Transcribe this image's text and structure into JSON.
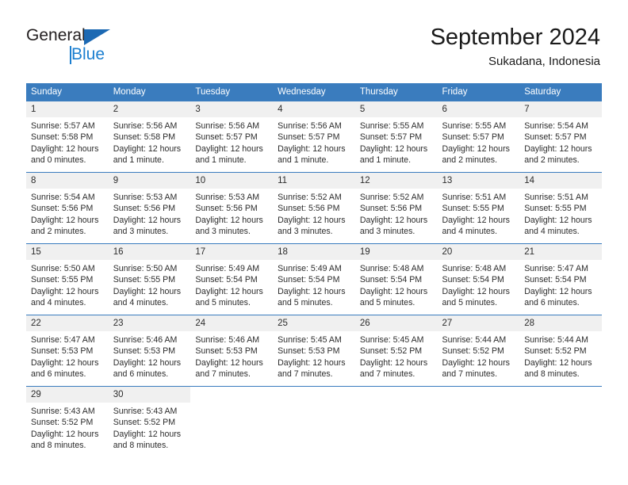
{
  "brand": {
    "name_top": "General",
    "name_bottom": "Blue",
    "accent_color": "#1c7fd0",
    "triangle_color": "#1c69b3"
  },
  "header": {
    "title": "September 2024",
    "subtitle": "Sukadana, Indonesia"
  },
  "calendar": {
    "header_bg": "#3a7cbe",
    "daynum_bg": "#f0f0f0",
    "weekdays": [
      "Sunday",
      "Monday",
      "Tuesday",
      "Wednesday",
      "Thursday",
      "Friday",
      "Saturday"
    ],
    "weeks": [
      [
        {
          "day": "1",
          "sunrise": "Sunrise: 5:57 AM",
          "sunset": "Sunset: 5:58 PM",
          "daylight1": "Daylight: 12 hours",
          "daylight2": "and 0 minutes."
        },
        {
          "day": "2",
          "sunrise": "Sunrise: 5:56 AM",
          "sunset": "Sunset: 5:58 PM",
          "daylight1": "Daylight: 12 hours",
          "daylight2": "and 1 minute."
        },
        {
          "day": "3",
          "sunrise": "Sunrise: 5:56 AM",
          "sunset": "Sunset: 5:57 PM",
          "daylight1": "Daylight: 12 hours",
          "daylight2": "and 1 minute."
        },
        {
          "day": "4",
          "sunrise": "Sunrise: 5:56 AM",
          "sunset": "Sunset: 5:57 PM",
          "daylight1": "Daylight: 12 hours",
          "daylight2": "and 1 minute."
        },
        {
          "day": "5",
          "sunrise": "Sunrise: 5:55 AM",
          "sunset": "Sunset: 5:57 PM",
          "daylight1": "Daylight: 12 hours",
          "daylight2": "and 1 minute."
        },
        {
          "day": "6",
          "sunrise": "Sunrise: 5:55 AM",
          "sunset": "Sunset: 5:57 PM",
          "daylight1": "Daylight: 12 hours",
          "daylight2": "and 2 minutes."
        },
        {
          "day": "7",
          "sunrise": "Sunrise: 5:54 AM",
          "sunset": "Sunset: 5:57 PM",
          "daylight1": "Daylight: 12 hours",
          "daylight2": "and 2 minutes."
        }
      ],
      [
        {
          "day": "8",
          "sunrise": "Sunrise: 5:54 AM",
          "sunset": "Sunset: 5:56 PM",
          "daylight1": "Daylight: 12 hours",
          "daylight2": "and 2 minutes."
        },
        {
          "day": "9",
          "sunrise": "Sunrise: 5:53 AM",
          "sunset": "Sunset: 5:56 PM",
          "daylight1": "Daylight: 12 hours",
          "daylight2": "and 3 minutes."
        },
        {
          "day": "10",
          "sunrise": "Sunrise: 5:53 AM",
          "sunset": "Sunset: 5:56 PM",
          "daylight1": "Daylight: 12 hours",
          "daylight2": "and 3 minutes."
        },
        {
          "day": "11",
          "sunrise": "Sunrise: 5:52 AM",
          "sunset": "Sunset: 5:56 PM",
          "daylight1": "Daylight: 12 hours",
          "daylight2": "and 3 minutes."
        },
        {
          "day": "12",
          "sunrise": "Sunrise: 5:52 AM",
          "sunset": "Sunset: 5:56 PM",
          "daylight1": "Daylight: 12 hours",
          "daylight2": "and 3 minutes."
        },
        {
          "day": "13",
          "sunrise": "Sunrise: 5:51 AM",
          "sunset": "Sunset: 5:55 PM",
          "daylight1": "Daylight: 12 hours",
          "daylight2": "and 4 minutes."
        },
        {
          "day": "14",
          "sunrise": "Sunrise: 5:51 AM",
          "sunset": "Sunset: 5:55 PM",
          "daylight1": "Daylight: 12 hours",
          "daylight2": "and 4 minutes."
        }
      ],
      [
        {
          "day": "15",
          "sunrise": "Sunrise: 5:50 AM",
          "sunset": "Sunset: 5:55 PM",
          "daylight1": "Daylight: 12 hours",
          "daylight2": "and 4 minutes."
        },
        {
          "day": "16",
          "sunrise": "Sunrise: 5:50 AM",
          "sunset": "Sunset: 5:55 PM",
          "daylight1": "Daylight: 12 hours",
          "daylight2": "and 4 minutes."
        },
        {
          "day": "17",
          "sunrise": "Sunrise: 5:49 AM",
          "sunset": "Sunset: 5:54 PM",
          "daylight1": "Daylight: 12 hours",
          "daylight2": "and 5 minutes."
        },
        {
          "day": "18",
          "sunrise": "Sunrise: 5:49 AM",
          "sunset": "Sunset: 5:54 PM",
          "daylight1": "Daylight: 12 hours",
          "daylight2": "and 5 minutes."
        },
        {
          "day": "19",
          "sunrise": "Sunrise: 5:48 AM",
          "sunset": "Sunset: 5:54 PM",
          "daylight1": "Daylight: 12 hours",
          "daylight2": "and 5 minutes."
        },
        {
          "day": "20",
          "sunrise": "Sunrise: 5:48 AM",
          "sunset": "Sunset: 5:54 PM",
          "daylight1": "Daylight: 12 hours",
          "daylight2": "and 5 minutes."
        },
        {
          "day": "21",
          "sunrise": "Sunrise: 5:47 AM",
          "sunset": "Sunset: 5:54 PM",
          "daylight1": "Daylight: 12 hours",
          "daylight2": "and 6 minutes."
        }
      ],
      [
        {
          "day": "22",
          "sunrise": "Sunrise: 5:47 AM",
          "sunset": "Sunset: 5:53 PM",
          "daylight1": "Daylight: 12 hours",
          "daylight2": "and 6 minutes."
        },
        {
          "day": "23",
          "sunrise": "Sunrise: 5:46 AM",
          "sunset": "Sunset: 5:53 PM",
          "daylight1": "Daylight: 12 hours",
          "daylight2": "and 6 minutes."
        },
        {
          "day": "24",
          "sunrise": "Sunrise: 5:46 AM",
          "sunset": "Sunset: 5:53 PM",
          "daylight1": "Daylight: 12 hours",
          "daylight2": "and 7 minutes."
        },
        {
          "day": "25",
          "sunrise": "Sunrise: 5:45 AM",
          "sunset": "Sunset: 5:53 PM",
          "daylight1": "Daylight: 12 hours",
          "daylight2": "and 7 minutes."
        },
        {
          "day": "26",
          "sunrise": "Sunrise: 5:45 AM",
          "sunset": "Sunset: 5:52 PM",
          "daylight1": "Daylight: 12 hours",
          "daylight2": "and 7 minutes."
        },
        {
          "day": "27",
          "sunrise": "Sunrise: 5:44 AM",
          "sunset": "Sunset: 5:52 PM",
          "daylight1": "Daylight: 12 hours",
          "daylight2": "and 7 minutes."
        },
        {
          "day": "28",
          "sunrise": "Sunrise: 5:44 AM",
          "sunset": "Sunset: 5:52 PM",
          "daylight1": "Daylight: 12 hours",
          "daylight2": "and 8 minutes."
        }
      ],
      [
        {
          "day": "29",
          "sunrise": "Sunrise: 5:43 AM",
          "sunset": "Sunset: 5:52 PM",
          "daylight1": "Daylight: 12 hours",
          "daylight2": "and 8 minutes."
        },
        {
          "day": "30",
          "sunrise": "Sunrise: 5:43 AM",
          "sunset": "Sunset: 5:52 PM",
          "daylight1": "Daylight: 12 hours",
          "daylight2": "and 8 minutes."
        },
        {
          "day": "",
          "sunrise": "",
          "sunset": "",
          "daylight1": "",
          "daylight2": ""
        },
        {
          "day": "",
          "sunrise": "",
          "sunset": "",
          "daylight1": "",
          "daylight2": ""
        },
        {
          "day": "",
          "sunrise": "",
          "sunset": "",
          "daylight1": "",
          "daylight2": ""
        },
        {
          "day": "",
          "sunrise": "",
          "sunset": "",
          "daylight1": "",
          "daylight2": ""
        },
        {
          "day": "",
          "sunrise": "",
          "sunset": "",
          "daylight1": "",
          "daylight2": ""
        }
      ]
    ]
  }
}
